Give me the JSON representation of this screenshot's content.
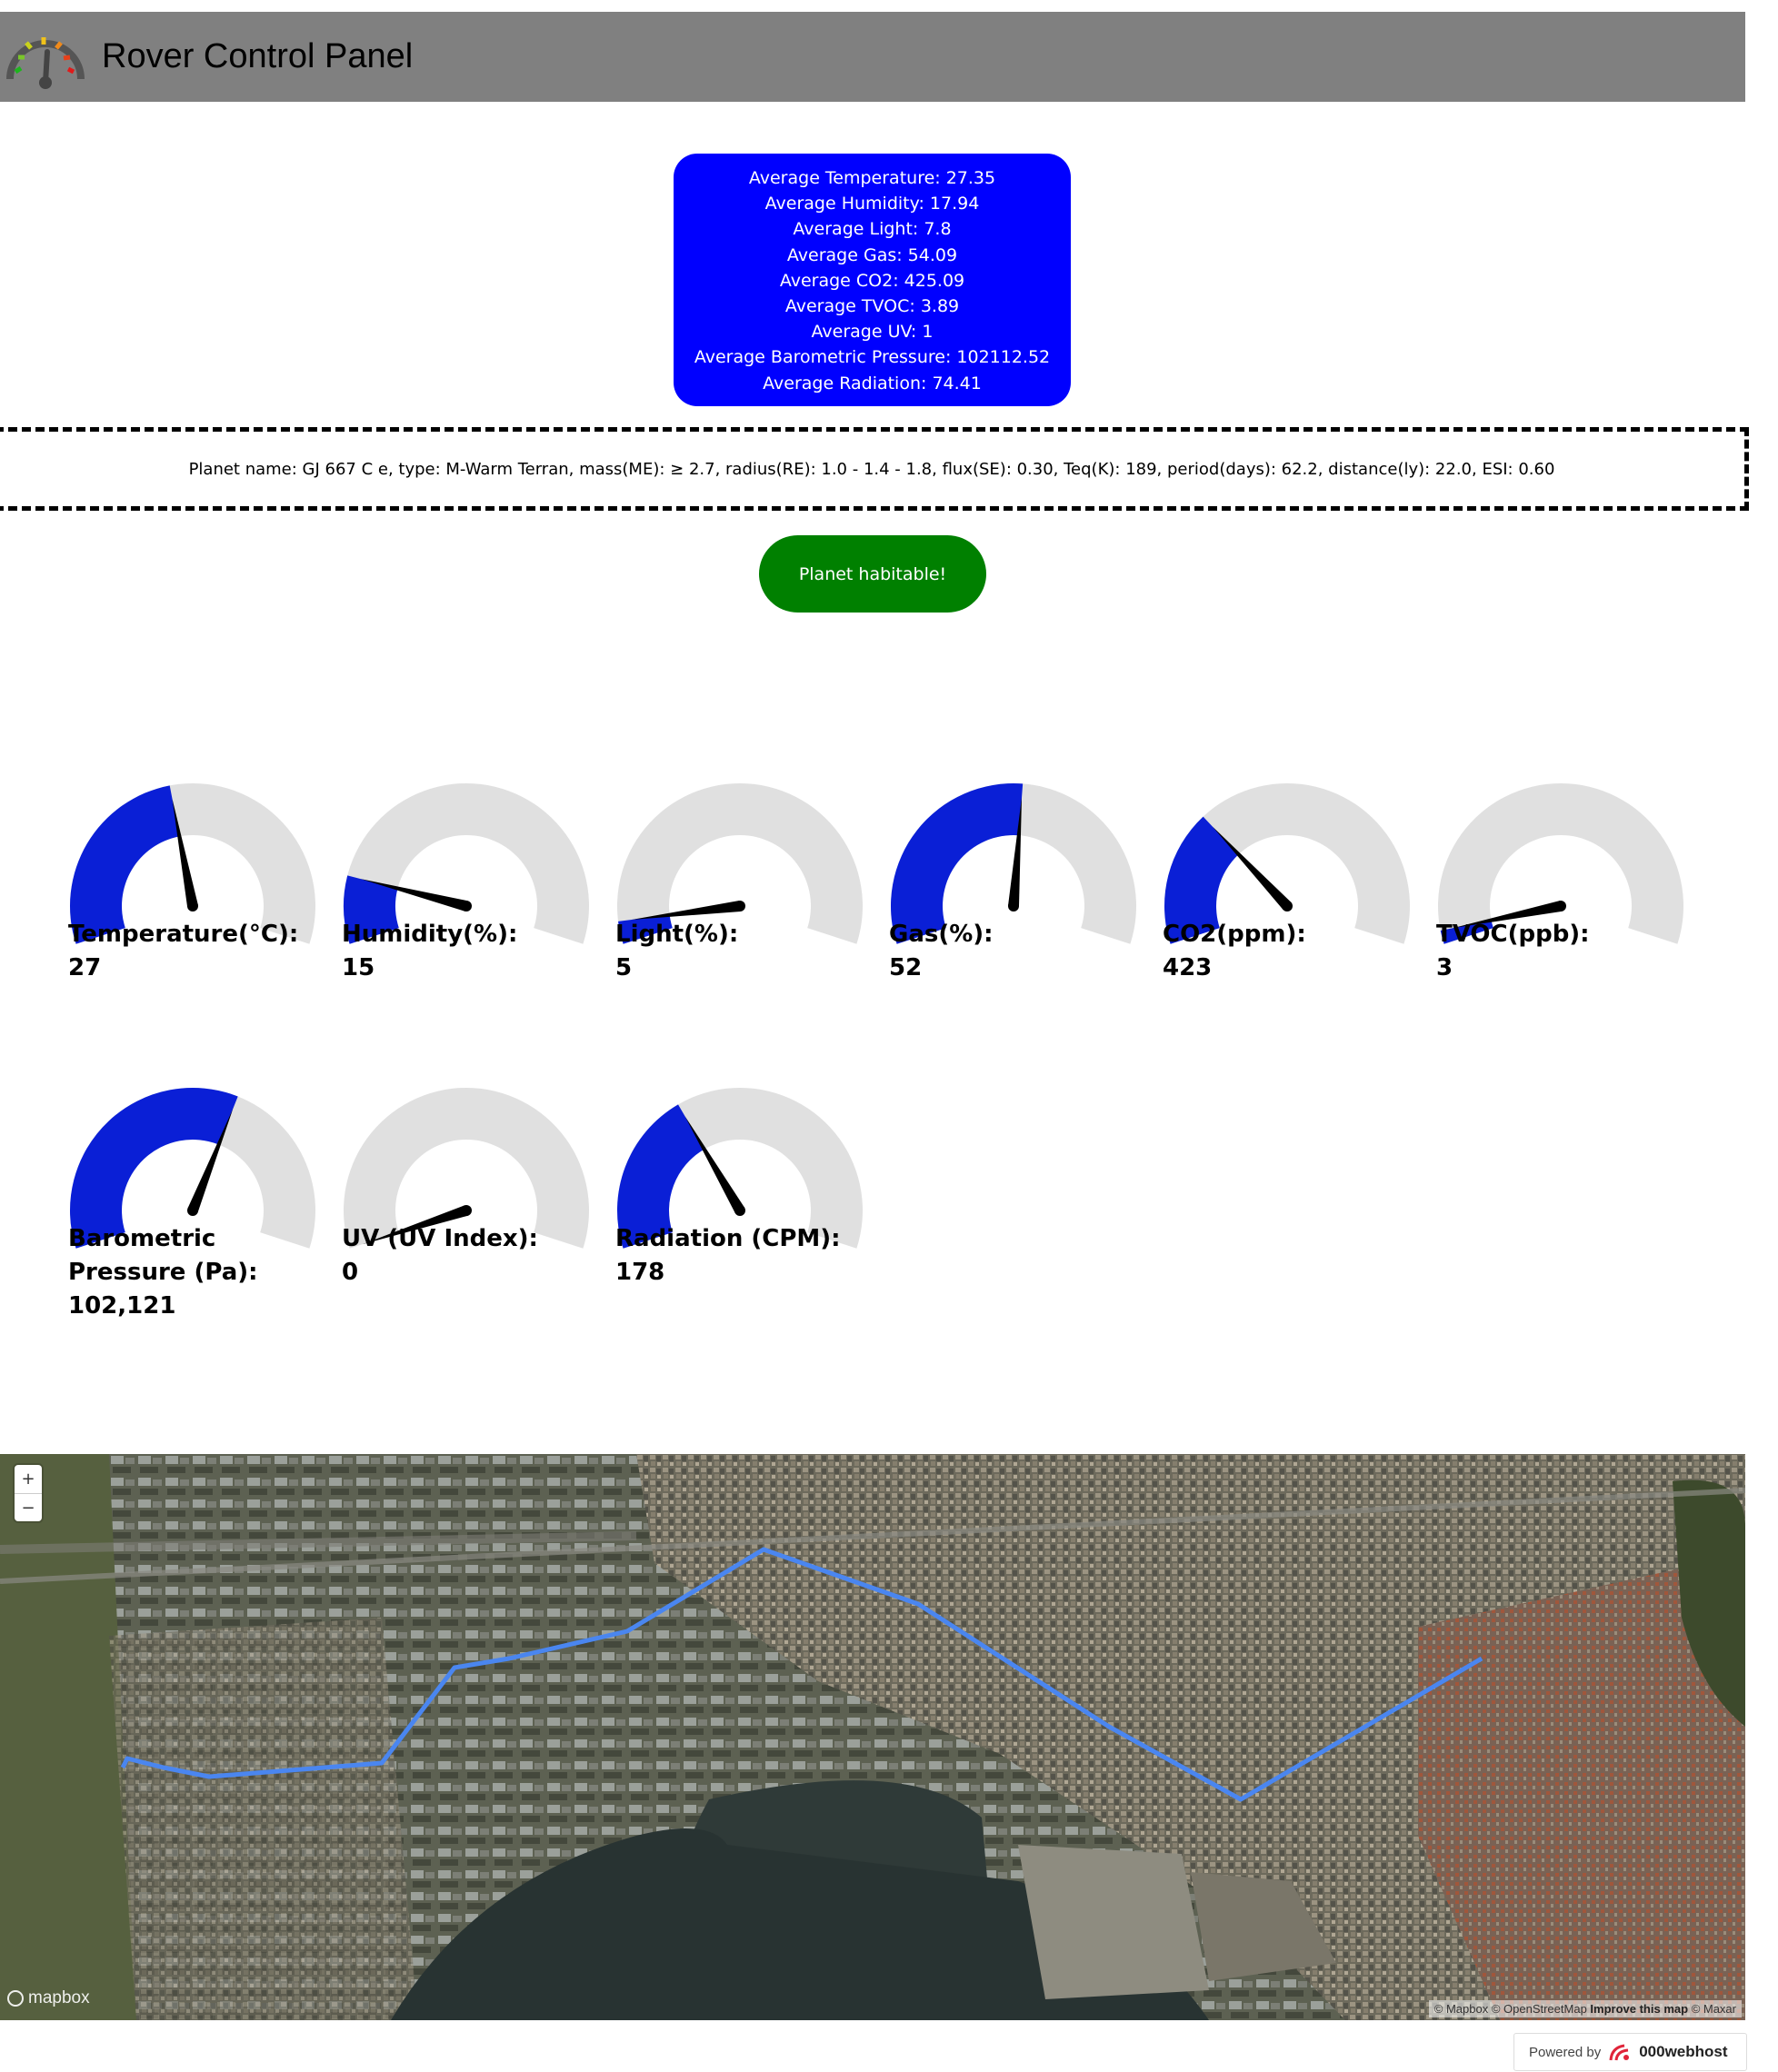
{
  "header": {
    "title": "Rover Control Panel"
  },
  "averages": [
    "Average Temperature: 27.35",
    "Average Humidity: 17.94",
    "Average Light: 7.8",
    "Average Gas: 54.09",
    "Average CO2: 425.09",
    "Average TVOC: 3.89",
    "Average UV: 1",
    "Average Barometric Pressure: 102112.52",
    "Average Radiation: 74.41"
  ],
  "planet_info": "Planet name: GJ 667 C e, type: M-Warm Terran, mass(ME): ≥ 2.7, radius(RE): 1.0 - 1.4 - 1.8, flux(SE): 0.30, Teq(K): 189, period(days): 62.2, distance(ly): 22.0, ESI: 0.60",
  "habitable_label": "Planet habitable!",
  "colors": {
    "gauge_fill": "#0a1fd6",
    "gauge_track": "#e0e0e0",
    "avg_box": "#0000ff",
    "habitable": "#008000",
    "header": "#808080",
    "route": "#4a86f0"
  },
  "gauges": [
    {
      "label": "Temperature(°C):",
      "value": "27",
      "fraction": 0.45
    },
    {
      "label": "Humidity(%):",
      "value": "15",
      "fraction": 0.15
    },
    {
      "label": "Light(%):",
      "value": "5",
      "fraction": 0.05
    },
    {
      "label": "Gas(%):",
      "value": "52",
      "fraction": 0.52
    },
    {
      "label": "CO2(ppm):",
      "value": "423",
      "fraction": 0.3
    },
    {
      "label": "TVOC(ppb):",
      "value": "3",
      "fraction": 0.03
    },
    {
      "label": "Barometric Pressure (Pa):",
      "value": "102,121",
      "fraction": 0.6
    },
    {
      "label": "UV (UV Index):",
      "value": "0",
      "fraction": 0.0
    },
    {
      "label": "Radiation (CPM):",
      "value": "178",
      "fraction": 0.36
    }
  ],
  "map": {
    "zoom_in": "+",
    "zoom_out": "−",
    "logo": "mapbox",
    "attribution_mapbox": "© Mapbox",
    "attribution_osm": "© OpenStreetMap",
    "attribution_improve": "Improve this map",
    "attribution_maxar": "© Maxar"
  },
  "footer": {
    "powered_by": "Powered by",
    "brand": "000webhost"
  }
}
